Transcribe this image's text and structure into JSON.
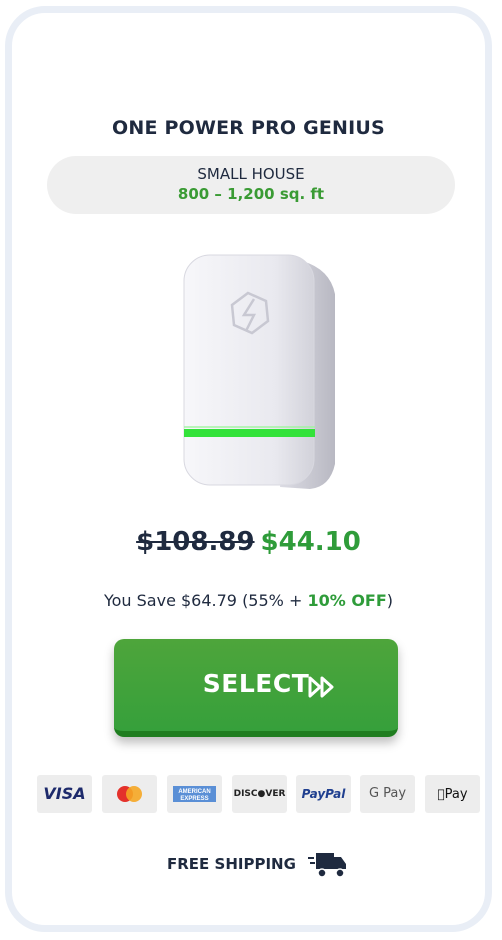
{
  "product": {
    "title": "ONE POWER PRO GENIUS",
    "size_label": "SMALL HOUSE",
    "size_range": "800 – 1,200 sq. ft",
    "image_icon": "plug-in-device-image"
  },
  "pricing": {
    "old_price": "$108.89",
    "new_price": "$44.10",
    "save_prefix": "You Save $64.79 (55% + ",
    "save_off": "10% OFF",
    "save_suffix": ")"
  },
  "cta": {
    "label": "SELECT",
    "icon": "double-chevron-right-icon"
  },
  "payments": {
    "visa": "VISA",
    "mastercard": "mastercard-icon",
    "amex_line1": "AMERICAN",
    "amex_line2": "EXPRESS",
    "discover": "DISC●VER",
    "paypal": "PayPal",
    "gpay": "G Pay",
    "apay": "Pay"
  },
  "shipping": {
    "label": "FREE SHIPPING",
    "icon": "delivery-truck-icon"
  },
  "colors": {
    "accent_green": "#2f9c3a",
    "button_green": "#4ea53b",
    "text_dark": "#1f2a3f"
  }
}
